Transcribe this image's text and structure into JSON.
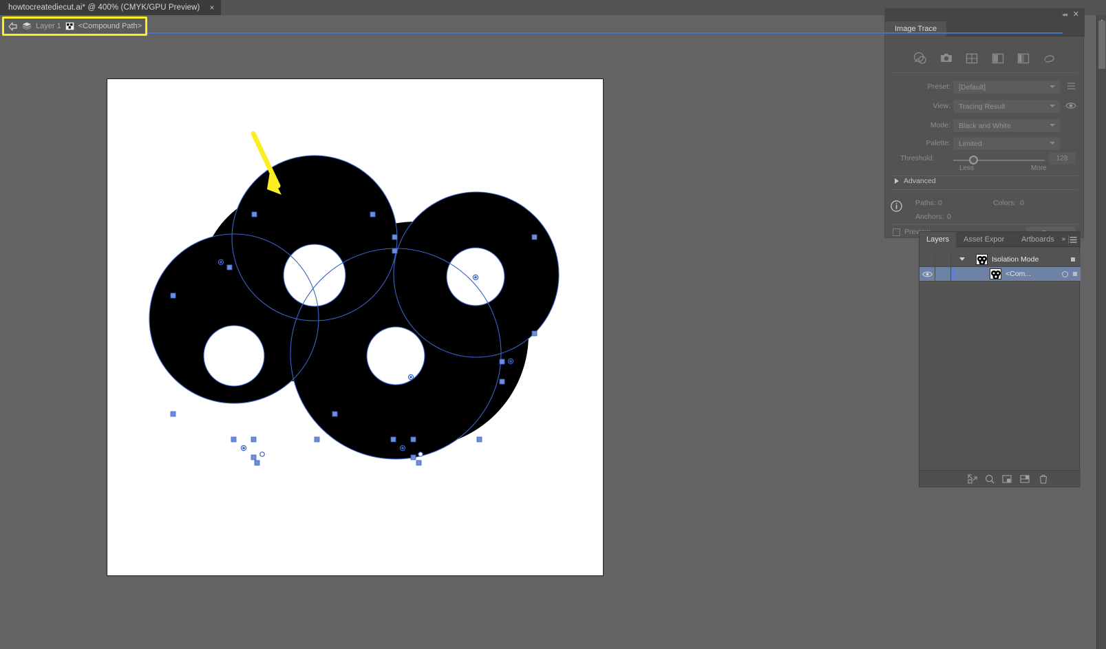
{
  "app": {
    "document_tab": {
      "title": "howtocreatediecut.ai* @ 400% (CMYK/GPU Preview)",
      "close_label": "×"
    }
  },
  "breadcrumb": {
    "back_icon": "back-arrow-icon",
    "layer_icon": "layers-stack-icon",
    "layer_label": "Layer 1",
    "object_icon": "compound-path-icon",
    "object_label": "<Compound Path>"
  },
  "image_trace": {
    "panel_title": "Image Trace",
    "collapse_label": "◂◂",
    "close_label": "✕",
    "preset_icons": [
      "auto-color-icon",
      "high-color-icon",
      "low-color-icon",
      "grayscale-icon",
      "black-and-white-icon",
      "outline-icon"
    ],
    "fields": [
      {
        "label": "Preset:",
        "value": "[Default]"
      },
      {
        "label": "View:",
        "value": "Tracing Result"
      },
      {
        "label": "Mode:",
        "value": "Black and White"
      },
      {
        "label": "Palette:",
        "value": "Limited"
      }
    ],
    "threshold": {
      "label": "Threshold:",
      "value": "128",
      "less_label": "Less",
      "more_label": "More",
      "knob_percent": 50
    },
    "advanced_label": "Advanced",
    "info": {
      "paths_label": "Paths:",
      "paths_value": "0",
      "colors_label": "Colors:",
      "colors_value": "0",
      "anchors_label": "Anchors:",
      "anchors_value": "0"
    },
    "preview_label": "Preview",
    "trace_button": "Trace"
  },
  "layers_panel": {
    "tabs": [
      {
        "label": "Layers",
        "active": true
      },
      {
        "label": "Asset Expor",
        "active": false
      },
      {
        "label": "Artboards",
        "active": false
      }
    ],
    "more_label": "»",
    "rows": [
      {
        "name": "Isolation Mode",
        "visible": false,
        "selected": false,
        "expanded": true
      },
      {
        "name": "<Com...",
        "visible": true,
        "selected": true,
        "expanded": false
      }
    ],
    "footer_icons": [
      "locate-object-icon",
      "make-clipping-mask-icon",
      "create-new-sublayer-icon",
      "create-new-layer-icon",
      "delete-selection-icon"
    ]
  },
  "canvas": {
    "artboard_background": "#ffffff",
    "artwork_fill": "#000000",
    "isolation_border_color": "#a44a4a",
    "selection_color": "#5b7ed6",
    "annotation_arrow_color": "#fcee21"
  }
}
